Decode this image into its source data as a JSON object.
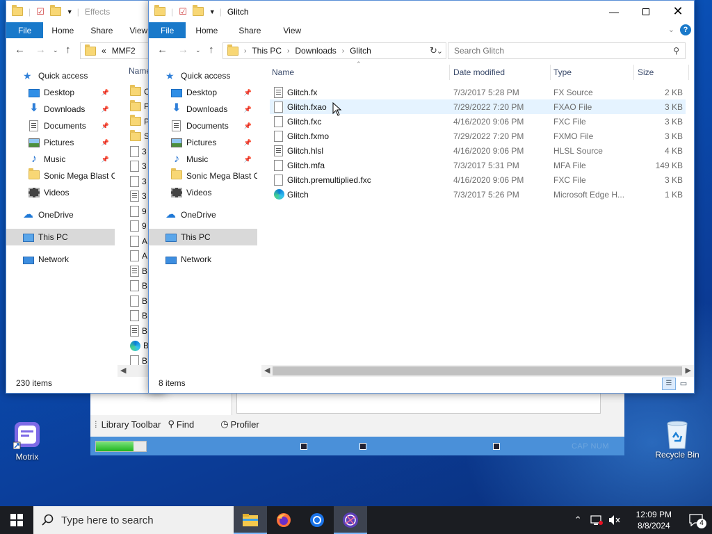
{
  "desktop": {
    "icons": [
      {
        "label": "Motrix",
        "icon": "motrix-app-icon"
      },
      {
        "label": "Recycle Bin",
        "icon": "recycle-bin-icon"
      }
    ]
  },
  "background_app": {
    "toolbar": {
      "library_toolbar": "Library Toolbar",
      "find": "Find",
      "profiler": "Profiler"
    },
    "status": {
      "caps_num": "CAP NUM",
      "progress_fraction": 0.75,
      "progress_color": "#1fb51f"
    }
  },
  "window_back": {
    "title": "Effects",
    "ribbon_tabs": [
      "File",
      "Home",
      "Share",
      "View"
    ],
    "breadcrumb": {
      "prefix": "«",
      "items": [
        "MMF2"
      ]
    },
    "column_name": "Name",
    "nav": {
      "quick_access": "Quick access",
      "items": [
        "Desktop",
        "Downloads",
        "Documents",
        "Pictures",
        "Music",
        "Sonic Mega Blast O",
        "Videos"
      ],
      "onedrive": "OneDrive",
      "this_pc": "This PC",
      "network": "Network"
    },
    "file_stub_letters": [
      "C",
      "P",
      "P",
      "S",
      "3",
      "3",
      "3",
      "3",
      "9",
      "9",
      "A",
      "A",
      "B",
      "B",
      "B",
      "B",
      "B",
      "B",
      "B"
    ],
    "status": "230 items"
  },
  "window_front": {
    "title": "Glitch",
    "ribbon_tabs": [
      "File",
      "Home",
      "Share",
      "View"
    ],
    "breadcrumb": [
      "This PC",
      "Downloads",
      "Glitch"
    ],
    "search_placeholder": "Search Glitch",
    "columns": {
      "name": "Name",
      "date": "Date modified",
      "type": "Type",
      "size": "Size"
    },
    "nav": {
      "quick_access": "Quick access",
      "items": [
        "Desktop",
        "Downloads",
        "Documents",
        "Pictures",
        "Music",
        "Sonic Mega Blast O",
        "Videos"
      ],
      "onedrive": "OneDrive",
      "this_pc": "This PC",
      "network": "Network"
    },
    "files": [
      {
        "name": "Glitch.fx",
        "date": "7/3/2017 5:28 PM",
        "type": "FX Source",
        "size": "2 KB",
        "icon": "text-document-icon"
      },
      {
        "name": "Glitch.fxao",
        "date": "7/29/2022 7:20 PM",
        "type": "FXAO File",
        "size": "3 KB",
        "icon": "blank-file-icon"
      },
      {
        "name": "Glitch.fxc",
        "date": "4/16/2020 9:06 PM",
        "type": "FXC File",
        "size": "3 KB",
        "icon": "blank-file-icon"
      },
      {
        "name": "Glitch.fxmo",
        "date": "7/29/2022 7:20 PM",
        "type": "FXMO File",
        "size": "3 KB",
        "icon": "blank-file-icon"
      },
      {
        "name": "Glitch.hlsl",
        "date": "4/16/2020 9:06 PM",
        "type": "HLSL Source",
        "size": "4 KB",
        "icon": "text-document-icon"
      },
      {
        "name": "Glitch.mfa",
        "date": "7/3/2017 5:31 PM",
        "type": "MFA File",
        "size": "149 KB",
        "icon": "blank-file-icon"
      },
      {
        "name": "Glitch.premultiplied.fxc",
        "date": "4/16/2020 9:06 PM",
        "type": "FXC File",
        "size": "3 KB",
        "icon": "blank-file-icon"
      },
      {
        "name": "Glitch",
        "date": "7/3/2017 5:26 PM",
        "type": "Microsoft Edge H...",
        "size": "1 KB",
        "icon": "edge-html-icon"
      }
    ],
    "status": "8 items"
  },
  "taskbar": {
    "search_placeholder": "Type here to search",
    "apps": [
      "file-explorer-icon",
      "firefox-icon",
      "chrome-icon",
      "motrix-icon"
    ],
    "clock": {
      "time": "12:09 PM",
      "date": "8/8/2024"
    },
    "notifications": "4"
  },
  "colors": {
    "accent": "#1979ca",
    "hover_row": "#e5f3ff",
    "selected_nav": "#d9d9d9",
    "desktop": "#0b4fb4"
  }
}
